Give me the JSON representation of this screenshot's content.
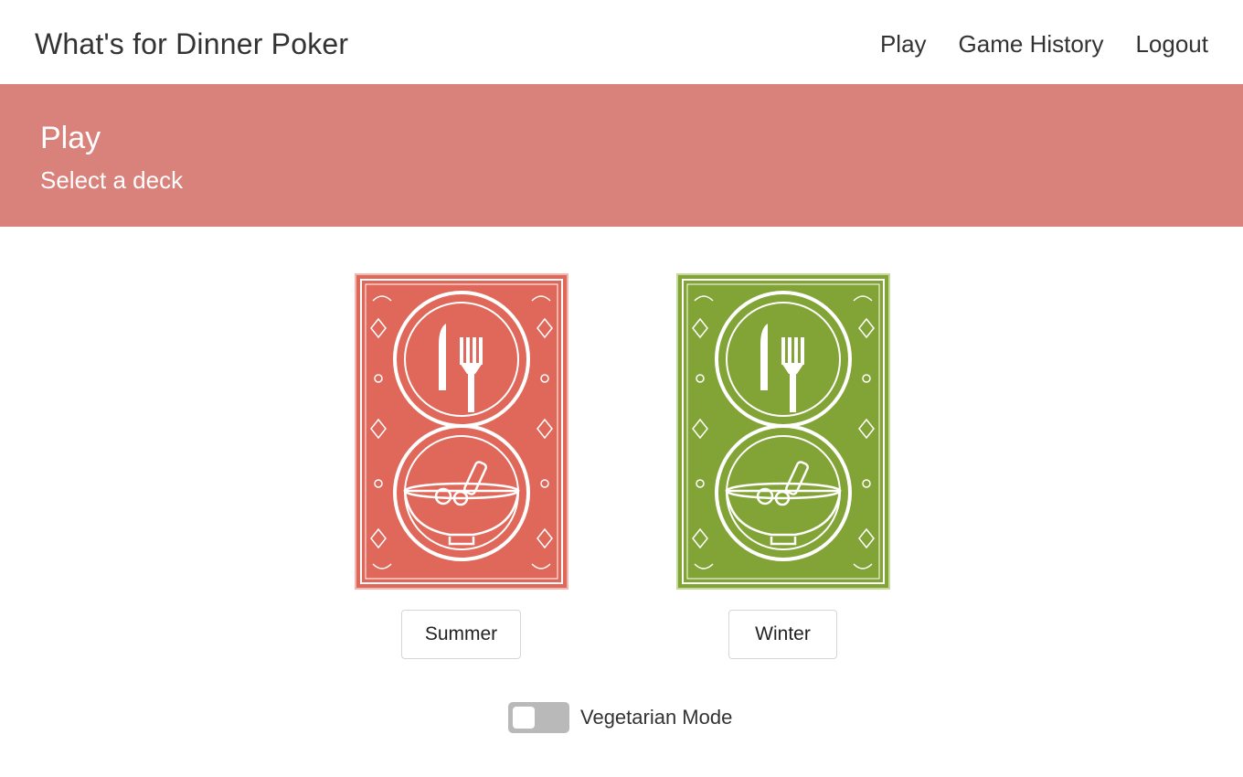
{
  "navbar": {
    "brand": "What's for Dinner Poker",
    "links": [
      "Play",
      "Game History",
      "Logout"
    ]
  },
  "banner": {
    "title": "Play",
    "subtitle": "Select a deck"
  },
  "decks": [
    {
      "label": "Summer",
      "color": "#e0685a"
    },
    {
      "label": "Winter",
      "color": "#82a336"
    }
  ],
  "options": {
    "vegetarian_label": "Vegetarian Mode",
    "vegetarian_on": false
  },
  "colors": {
    "banner": "#d9827b",
    "toggle_off": "#b9b9b9"
  },
  "icons": [
    "knife-icon",
    "fork-icon",
    "bowl-icon"
  ]
}
